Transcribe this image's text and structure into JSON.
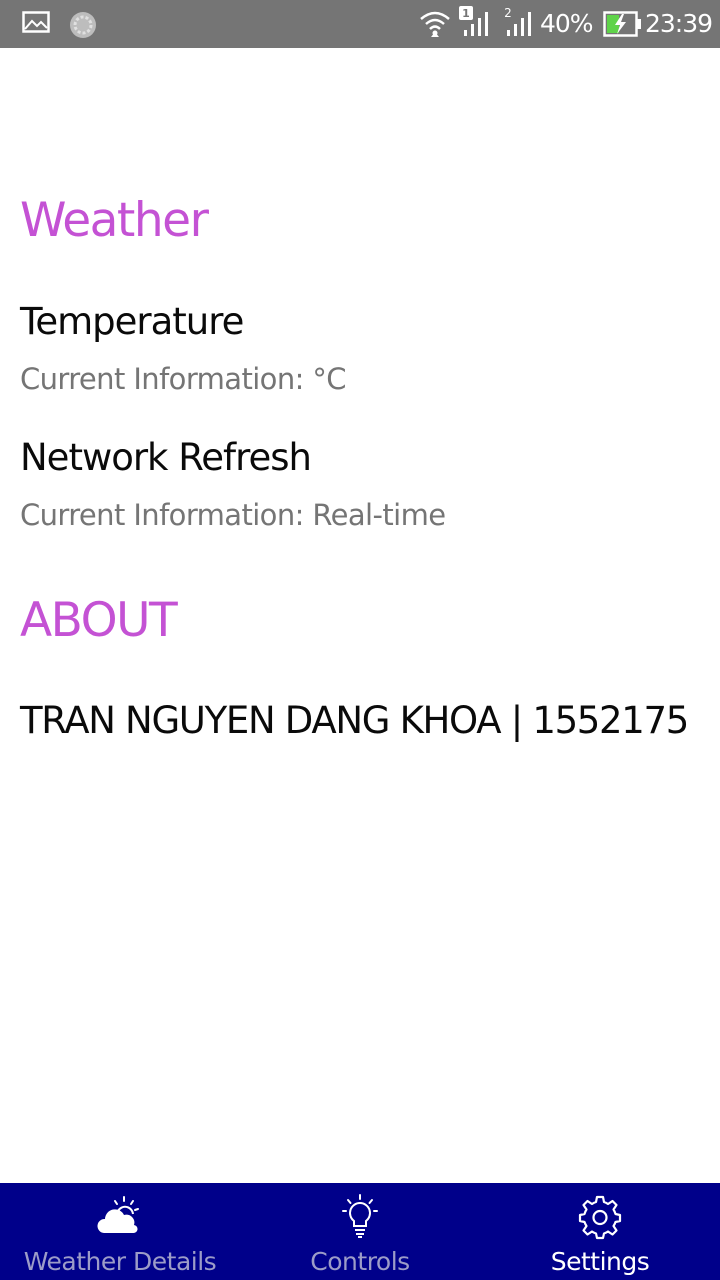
{
  "status_bar": {
    "battery_percent": "40%",
    "time": "23:39",
    "sim1_label": "1",
    "sim2_label": "2",
    "icons": [
      "gallery-icon",
      "sync-icon",
      "wifi-icon",
      "signal-icon",
      "signal-icon",
      "battery-charging-icon"
    ]
  },
  "weather_section": {
    "header": "Weather",
    "items": [
      {
        "title": "Temperature",
        "summary": "Current Information: °C"
      },
      {
        "title": "Network Refresh",
        "summary": "Current Information: Real-time"
      }
    ]
  },
  "about_section": {
    "header": "ABOUT",
    "text": "TRAN NGUYEN DANG KHOA | 1552175"
  },
  "bottom_nav": {
    "items": [
      {
        "label": "Weather Details",
        "icon": "cloud-sun-icon",
        "active": false
      },
      {
        "label": "Controls",
        "icon": "lightbulb-icon",
        "active": false
      },
      {
        "label": "Settings",
        "icon": "gear-icon",
        "active": true
      }
    ]
  },
  "colors": {
    "accent": "#c452d4",
    "nav_background": "#00008a",
    "status_bar": "#757575"
  }
}
